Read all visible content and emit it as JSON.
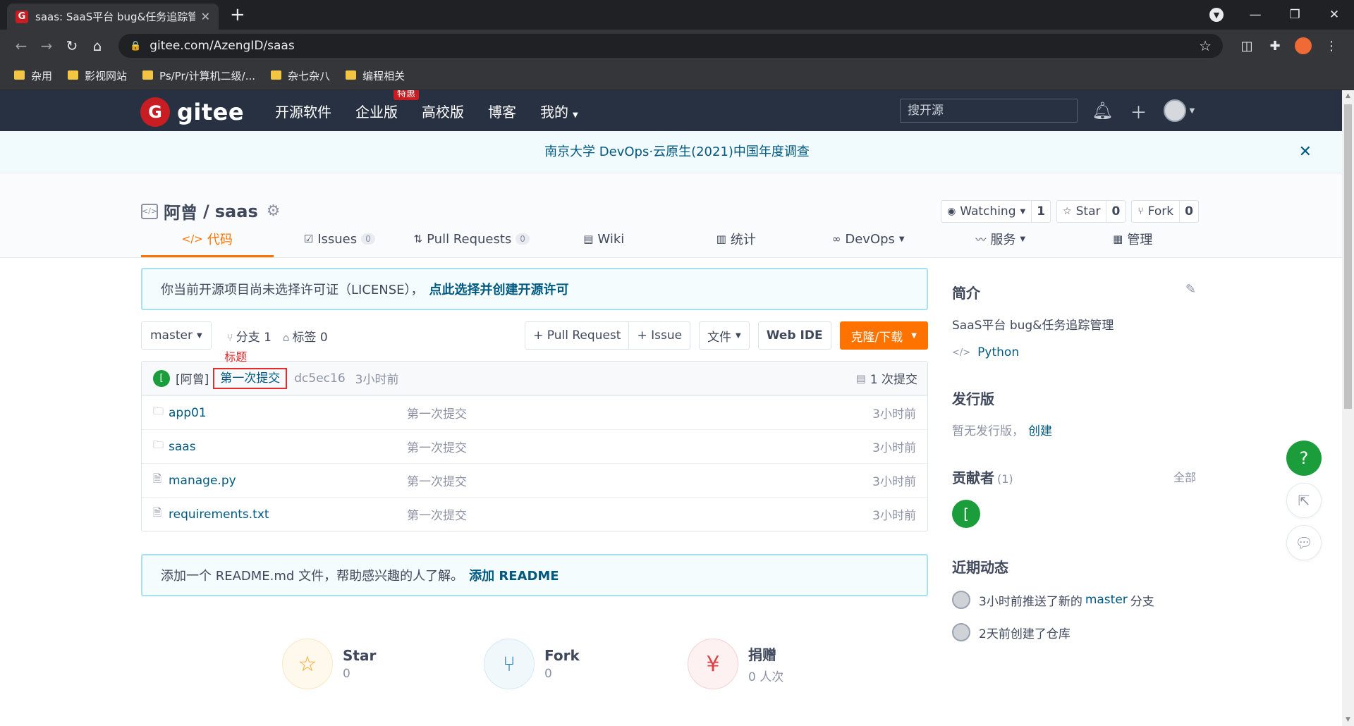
{
  "browser": {
    "tab_title": "saas: SaaS平台 bug&任务追踪管",
    "tab_favicon": "G",
    "url": "gitee.com/AzengID/saas",
    "bookmarks": [
      "杂用",
      "影视网站",
      "Ps/Pr/计算机二级/...",
      "杂七杂八",
      "编程相关"
    ]
  },
  "gitee": {
    "logo_text": "gitee",
    "logo_mark": "G",
    "nav": [
      "开源软件",
      "企业版",
      "高校版",
      "博客",
      "我的"
    ],
    "nav_badge": "特惠",
    "search_placeholder": "搜开源",
    "announcement": "南京大学 DevOps·云原生(2021)中国年度调查"
  },
  "project": {
    "owner": "阿曾",
    "separator": "/",
    "name": "saas",
    "watch_label": "Watching",
    "watch_count": "1",
    "star_label": "Star",
    "star_count": "0",
    "fork_label": "Fork",
    "fork_count": "0",
    "tabs": [
      {
        "label": "代码"
      },
      {
        "label": "Issues",
        "count": "0"
      },
      {
        "label": "Pull Requests",
        "count": "0"
      },
      {
        "label": "Wiki"
      },
      {
        "label": "统计"
      },
      {
        "label": "DevOps"
      },
      {
        "label": "服务"
      },
      {
        "label": "管理"
      }
    ]
  },
  "license_notice": {
    "text": "你当前开源项目尚未选择许可证（LICENSE），",
    "link": "点此选择并创建开源许可"
  },
  "branchbar": {
    "branch": "master",
    "branches": "分支 1",
    "tags": "标签 0",
    "pull_request": "+ Pull Request",
    "issue": "+ Issue",
    "file": "文件",
    "web_ide": "Web IDE",
    "clone": "克隆/下载"
  },
  "commit": {
    "avatar": "[",
    "author": "[阿曾]",
    "message": "第一次提交",
    "annotation": "标题",
    "hash": "dc5ec16",
    "time": "3小时前",
    "count": "1 次提交"
  },
  "files": [
    {
      "name": "app01",
      "type": "folder",
      "message": "第一次提交",
      "time": "3小时前"
    },
    {
      "name": "saas",
      "type": "folder",
      "message": "第一次提交",
      "time": "3小时前"
    },
    {
      "name": "manage.py",
      "type": "file",
      "message": "第一次提交",
      "time": "3小时前"
    },
    {
      "name": "requirements.txt",
      "type": "file",
      "message": "第一次提交",
      "time": "3小时前"
    }
  ],
  "readme_notice": {
    "text": "添加一个 README.md 文件，帮助感兴趣的人了解。",
    "link": "添加 README"
  },
  "stats": [
    {
      "label": "Star",
      "value": "0"
    },
    {
      "label": "Fork",
      "value": "0"
    },
    {
      "label": "捐赠",
      "value": "0 人次"
    }
  ],
  "sidebar": {
    "intro_title": "简介",
    "description": "SaaS平台 bug&任务追踪管理",
    "language": "Python",
    "release_title": "发行版",
    "no_release": "暂无发行版，",
    "create": "创建",
    "contributors_title": "贡献者",
    "contributors_count": "(1)",
    "all": "全部",
    "contributor_avatar": "[",
    "recent_title": "近期动态",
    "activity1_pre": "3小时前推送了新的",
    "activity1_branch": "master",
    "activity1_post": "分支",
    "activity2": "2天前创建了仓库"
  },
  "float_help": "?",
  "colors": {
    "header_bg": "#283142",
    "accent_orange": "#fe7300",
    "link_blue": "#005980",
    "brand_red": "#c71d23",
    "contrib_green": "#1c9d3b"
  }
}
